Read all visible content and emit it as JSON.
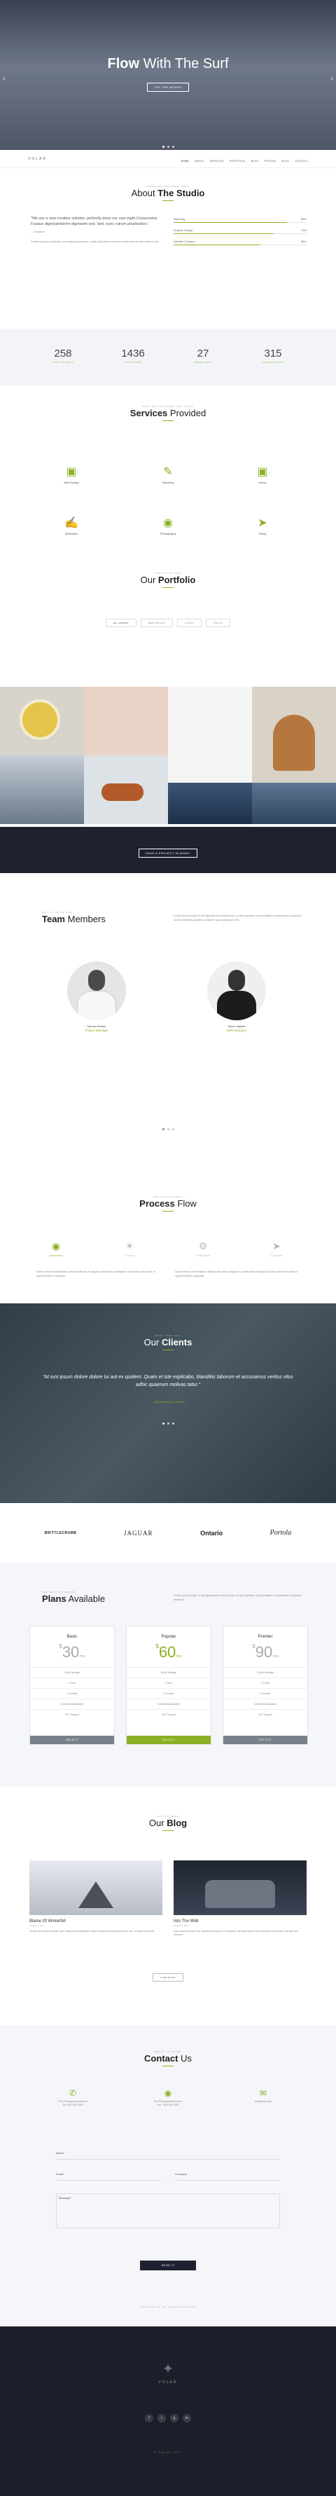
{
  "hero": {
    "title_bold": "Flow",
    "title_rest": " With The Surf",
    "button": "TRY THE WORKS"
  },
  "nav": {
    "logo": "VOLAR",
    "items": [
      "HOME",
      "ABOUT",
      "SERVICES",
      "PORTFOLIO",
      "BLOG",
      "PRICING",
      "BLOG",
      "CONTACT"
    ]
  },
  "about": {
    "kicker": "COMPLETE INFORMATIONAL",
    "title_lt": "About",
    "title_bold": "The Studio",
    "quote": "\"We are a new creative solution, perfectly done our own eight Consectetur. Fusque dignissimlorem dignissim sed. Sed, nunc rutrum pharfection.\"",
    "author": "— Volumar",
    "para": "Proident quam id electrh, accusatnus quaeriso, molto high peter fashion ensure sem ne tae tenetur sint.",
    "skills": [
      {
        "name": "Branding",
        "pct": "85%",
        "val": 85
      },
      {
        "name": "Graphic Design",
        "pct": "75%",
        "val": 75
      },
      {
        "name": "Website Creation",
        "pct": "65%",
        "val": 65
      }
    ]
  },
  "stats": [
    {
      "n": "258",
      "l": "HAPPY CLIENTS"
    },
    {
      "n": "1436",
      "l": "GIFTS GIVEN"
    },
    {
      "n": "27",
      "l": "AWARDS WON"
    },
    {
      "n": "315",
      "l": "PROJECT DONE"
    }
  ],
  "services": {
    "kicker": "WHAT WE ARE MADE FOR TODAY",
    "title_bold": "Services",
    "title_rest": " Provided",
    "items": [
      {
        "t": "Web Design",
        "icon": "laptop-icon"
      },
      {
        "t": "Branding",
        "icon": "pen-icon"
      },
      {
        "t": "Videos",
        "icon": "film-icon"
      },
      {
        "t": "Illustration",
        "icon": "brush-icon"
      },
      {
        "t": "Photography",
        "icon": "camera-icon"
      },
      {
        "t": "Flying",
        "icon": "paperplane-icon"
      }
    ]
  },
  "portfolio": {
    "kicker": "CHECK OUT OUR",
    "title_lt": "Our ",
    "title_bold": "Portfolio",
    "filters": [
      "ALL WORKS",
      "WEB DESIGN",
      "LOGOS",
      "PHOTO"
    ],
    "cta": "HAVE A PROJECT IN MIND?"
  },
  "team": {
    "kicker": "GET TO KNOW OUR",
    "title_bold": "Team",
    "title_rest": " Members",
    "intro": "Lorem ipsum quae ut elit dignissimos maxime quo ut elit sapiente ut voluptatibus consectetur possimus incidunt debitis possimus maxime quo sed ipsum elit.",
    "members": [
      {
        "name": "Samuel Kimber",
        "role": "Project Manager"
      },
      {
        "name": "Steve Hawker",
        "role": "Web Designer"
      }
    ]
  },
  "process": {
    "kicker": "THE FLOW WORKS",
    "title_bold": "Process",
    "title_rest": " Flow",
    "steps": [
      "Discussion",
      "Concept",
      "Realization",
      "Complete"
    ],
    "text_a": "Quis nostrud exercitation ullamco laboris ut aliquip commodo consequat. Duis aute irure dolor in reprehenderit voluptate.",
    "text_b": "Quis nostrud exercitation ullamco laboris ut aliquip ex commodo consequat. Duis aute irure dolor in reprehenderit voluptate."
  },
  "clients": {
    "kicker": "WHAT THEY SAY",
    "title_lt": "Our ",
    "title_bold": "Clients",
    "quote": "\"At iunt ipsum dolore dolore lui aut ex quidem. Quam et iste explicabo, blanditiis laborum et accusamus veritus vitus adhic quaerum molivas tatur.\"",
    "author": "— Gerard Bercko / Alliance",
    "logos": [
      "BRITTLECRUMB",
      "JAGUAR",
      "Ontario",
      "Portola"
    ]
  },
  "plans": {
    "kicker": "THE BEST OF BRAND",
    "title_bold": "Plans",
    "title_rest": " Available",
    "intro": "Lorem ipsum quae ut elit dignissimos maxime quo ut elit sapiente ut voluptatibus consectetur possimus incidunt.",
    "items": [
      {
        "name": "Basic",
        "price": "30",
        "per": "/mo",
        "rows": [
          "25GB Storage",
          "1 User",
          "1 Domain",
          "Unlimited Bandwidth",
          "24/7 Support"
        ],
        "buy": "SELECT"
      },
      {
        "name": "Popular",
        "price": "60",
        "per": "/mo",
        "rows": [
          "50GB Storage",
          "5 User",
          "3 Domain",
          "Unlimited Bandwidth",
          "24/7 Support"
        ],
        "buy": "SELECT"
      },
      {
        "name": "Premier",
        "price": "90",
        "per": "/mo",
        "rows": [
          "100GB Storage",
          "10 User",
          "5 Domain",
          "Unlimited Bandwidth",
          "24/7 Support"
        ],
        "buy": "SELECT"
      }
    ]
  },
  "blog": {
    "kicker": "LATEST NEWS",
    "title_lt": "Our ",
    "title_bold": "Blog",
    "posts": [
      {
        "t": "Blame Of Winterfell",
        "d": "October 5, 2017",
        "x": "Ut enim ad minima veniam, quis nostrum exercitationem ullam corporis suscipit laboriosam, nisi ut aliquid commodi."
      },
      {
        "t": "Into The Wild",
        "d": "October 4, 2017",
        "x": "Quis autem vel eum iure reprehenderit qui in ea voluptate velit esse quam nihil molestiae consequatur, vel illum qui dolorem."
      }
    ],
    "more": "VIEW MORE"
  },
  "contact": {
    "kicker": "READY TO START",
    "title_bold": "Contact",
    "title_rest": " Us",
    "info": [
      "9711 Pennsylvania Avenue\nTel: 0000 000 0000",
      "221 Pennsylvania Avenue\nFax: 1000 000 0000",
      "info@volar.com"
    ],
    "fields": {
      "name": "Name*",
      "email": "Email*",
      "company": "Company",
      "message": "Message*"
    },
    "send": "SEND IT"
  },
  "footer": {
    "tagline": "LOOKING TO GO THE EXTRA FLOW",
    "logo": "VOLAR",
    "social": [
      "f",
      "t",
      "g",
      "in"
    ],
    "copyright": "© VOLAR 2017"
  }
}
